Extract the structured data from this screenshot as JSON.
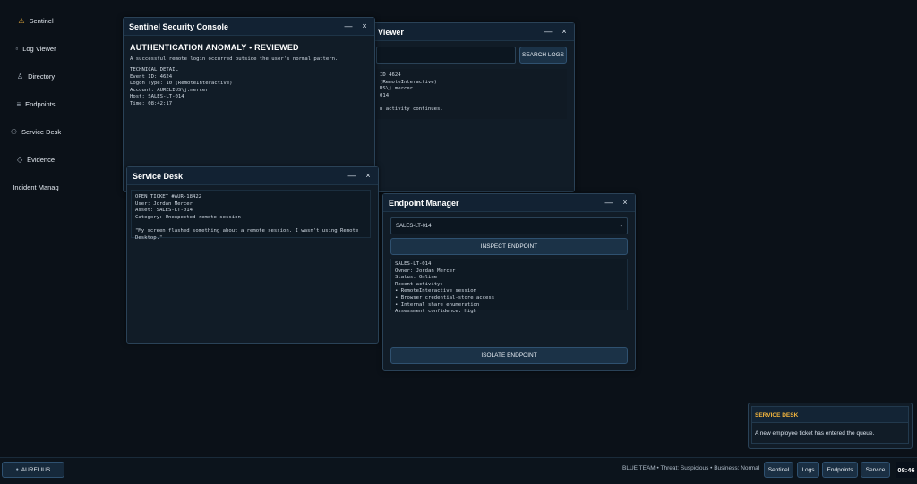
{
  "desktop_icons": [
    {
      "label": "Sentinel",
      "icon": "⚠"
    },
    {
      "label": "Log Viewer",
      "icon": "▫"
    },
    {
      "label": "Directory",
      "icon": "♙"
    },
    {
      "label": "Endpoints",
      "icon": "≡"
    },
    {
      "label": "Service Desk",
      "icon": "⚇"
    },
    {
      "label": "Evidence",
      "icon": "◇"
    },
    {
      "label": "Incident Manag",
      "icon": ""
    }
  ],
  "log_viewer": {
    "title": "Viewer",
    "search_value": "",
    "search_button": "SEARCH LOGS",
    "log_text": "ID 4624\n(RemoteInteractive)\nUS\\j.mercer\n014\n\nn activity continues."
  },
  "sentinel_console": {
    "title": "Sentinel Security Console",
    "alert_title": "AUTHENTICATION ANOMALY • REVIEWED",
    "alert_subtitle": "A successful remote login occurred outside the user's normal pattern.",
    "technical_detail": "TECHNICAL DETAIL\nEvent ID: 4624\nLogon Type: 10 (RemoteInteractive)\nAccount: AURELIUS\\j.mercer\nHost: SALES-LT-014\nTime: 08:42:17"
  },
  "service_desk": {
    "title": "Service Desk",
    "ticket_text": "OPEN TICKET #AUR-18422\nUser: Jordan Mercer\nAsset: SALES-LT-014\nCategory: Unexpected remote session\n\n\"My screen flashed something about a remote session. I wasn't using Remote Desktop.\""
  },
  "endpoint_manager": {
    "title": "Endpoint Manager",
    "selected_endpoint": "SALES-LT-014",
    "inspect_button": "INSPECT ENDPOINT",
    "details": "SALES-LT-014\nOwner: Jordan Mercer\nStatus: Online\nRecent activity:\n• RemoteInteractive session\n• Browser credential-store access\n• Internal share enumeration\nAssessment confidence: High",
    "isolate_button": "ISOLATE ENDPOINT"
  },
  "window_controls": {
    "minimize": "—",
    "close": "×"
  },
  "notification": {
    "heading": "SERVICE DESK",
    "message": "A new employee ticket has entered the queue."
  },
  "taskbar": {
    "start_label": "AURELIUS",
    "status": "BLUE TEAM • Threat: Suspicious • Business: Normal",
    "buttons": [
      "Sentinel",
      "Logs",
      "Endpoints",
      "Service"
    ],
    "clock": "08:46"
  },
  "colors": {
    "background": "#0b1118",
    "window": "#111c27",
    "border": "#2a4257",
    "accent_warning": "#f2b43d",
    "button": "#1b3247"
  }
}
